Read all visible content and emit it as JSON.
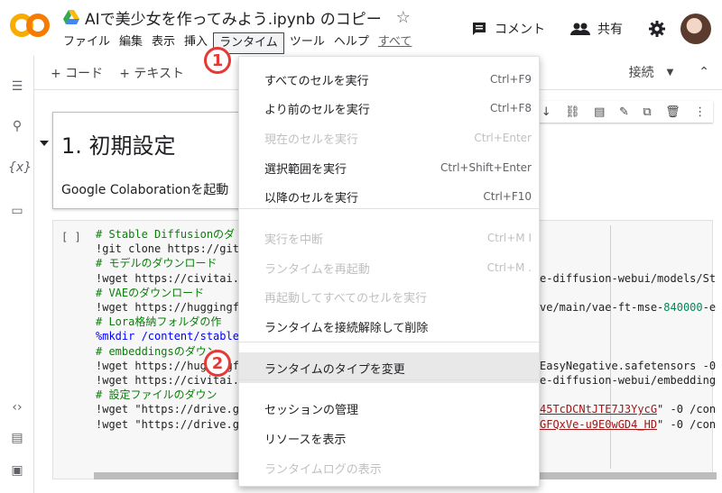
{
  "header": {
    "logo_text": "CO",
    "title": "AIで美少女を作ってみよう.ipynb のコピー",
    "menus": [
      "ファイル",
      "編集",
      "表示",
      "挿入",
      "ランタイム",
      "ツール",
      "ヘルプ",
      "すべて"
    ],
    "comment_label": "コメント",
    "share_label": "共有"
  },
  "toolbar": {
    "add_code": "+ コード",
    "add_text": "+ テキスト",
    "connect": "接続"
  },
  "text_cell": {
    "heading": "1. 初期設定",
    "subtitle": "Google Colaborationを起動"
  },
  "code_cell": {
    "bracket": "[ ]",
    "lines": [
      "# Stable Diffusionのダ",
      "!git clone https://git",
      "# モデルのダウンロード",
      "!wget https://civitai.",
      "# VAEのダウンロード",
      "!wget https://huggingf",
      "# Lora格納フォルダの作",
      "%mkdir /content/stable",
      "# embeddingsのダウン",
      "!wget https://huggingf",
      "!wget https://civitai.",
      "# 設定ファイルのダウン",
      "!wget \"https://drive.g",
      "!wget \"https://drive.g"
    ],
    "right_fragments": [
      {
        "row": 3,
        "text": "e-diffusion-webui/models/St"
      },
      {
        "row": 5,
        "text": "ve/main/vae-ft-mse-",
        "num": "840000",
        "tail": "-e"
      },
      {
        "row": 9,
        "text": "EasyNegative.safetensors -0"
      },
      {
        "row": 10,
        "text": "e-diffusion-webui/embedding"
      },
      {
        "row": 12,
        "text": "45TcDCNtJTE7J3YycG",
        "tail": "\" -0 /con"
      },
      {
        "row": 13,
        "text": "GFQxVe-u9E0wGD4_HD",
        "tail": "\" -0 /con"
      }
    ]
  },
  "runtime_menu": {
    "items": [
      {
        "label": "すべてのセルを実行",
        "shortcut": "Ctrl+F9",
        "disabled": false
      },
      {
        "label": "より前のセルを実行",
        "shortcut": "Ctrl+F8",
        "disabled": false
      },
      {
        "label": "現在のセルを実行",
        "shortcut": "Ctrl+Enter",
        "disabled": true
      },
      {
        "label": "選択範囲を実行",
        "shortcut": "Ctrl+Shift+Enter",
        "disabled": false
      },
      {
        "label": "以降のセルを実行",
        "shortcut": "Ctrl+F10",
        "disabled": false
      },
      {
        "label": "実行を中断",
        "shortcut": "Ctrl+M I",
        "disabled": true
      },
      {
        "label": "ランタイムを再起動",
        "shortcut": "Ctrl+M .",
        "disabled": true
      },
      {
        "label": "再起動してすべてのセルを実行",
        "shortcut": "",
        "disabled": true
      },
      {
        "label": "ランタイムを接続解除して削除",
        "shortcut": "",
        "disabled": false
      },
      {
        "label": "ランタイムのタイプを変更",
        "shortcut": "",
        "disabled": false
      },
      {
        "label": "セッションの管理",
        "shortcut": "",
        "disabled": false
      },
      {
        "label": "リソースを表示",
        "shortcut": "",
        "disabled": false
      },
      {
        "label": "ランタイムログの表示",
        "shortcut": "",
        "disabled": true
      }
    ]
  },
  "annotations": {
    "badge1": "1",
    "badge2": "2"
  },
  "colors": {
    "logo_orange": "#f9ab00",
    "badge_red": "#e53935"
  }
}
